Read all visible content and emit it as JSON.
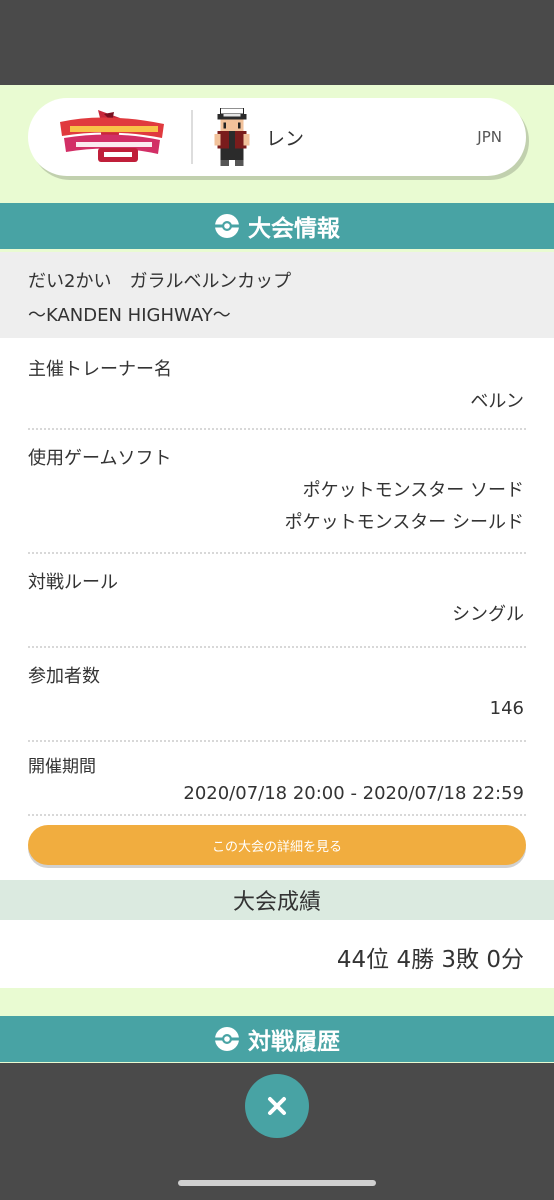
{
  "profile": {
    "game_logo_text": "ポケットモンスター シールド",
    "trainer_name": "レン",
    "region": "JPN"
  },
  "tournament_info": {
    "header_title": "大会情報",
    "name_line1": "だい2かい　ガラルベルンカップ",
    "name_line2": "〜KANDEN HIGHWAY〜",
    "rows": [
      {
        "label": "主催トレーナー名",
        "value_lines": [
          "ベルン"
        ]
      },
      {
        "label": "使用ゲームソフト",
        "value_lines": [
          "ポケットモンスター ソード",
          "ポケットモンスター シールド"
        ]
      },
      {
        "label": "対戦ルール",
        "value_lines": [
          "シングル"
        ]
      },
      {
        "label": "参加者数",
        "value_lines": [
          "146"
        ]
      },
      {
        "label": "開催期間",
        "value_lines": [
          "2020/07/18 20:00 - 2020/07/18 22:59"
        ]
      }
    ],
    "detail_button_label": "この大会の詳細を見る"
  },
  "results": {
    "header_title": "大会成績",
    "summary": "44位 4勝 3敗 0分"
  },
  "battle_history": {
    "header_title": "対戦履歴"
  },
  "colors": {
    "teal": "#48a3a4",
    "orange": "#f1ad3f",
    "page_bg": "#e9fbd2"
  },
  "icons": {
    "close": "close-icon",
    "pokeball": "pokeball-icon"
  }
}
